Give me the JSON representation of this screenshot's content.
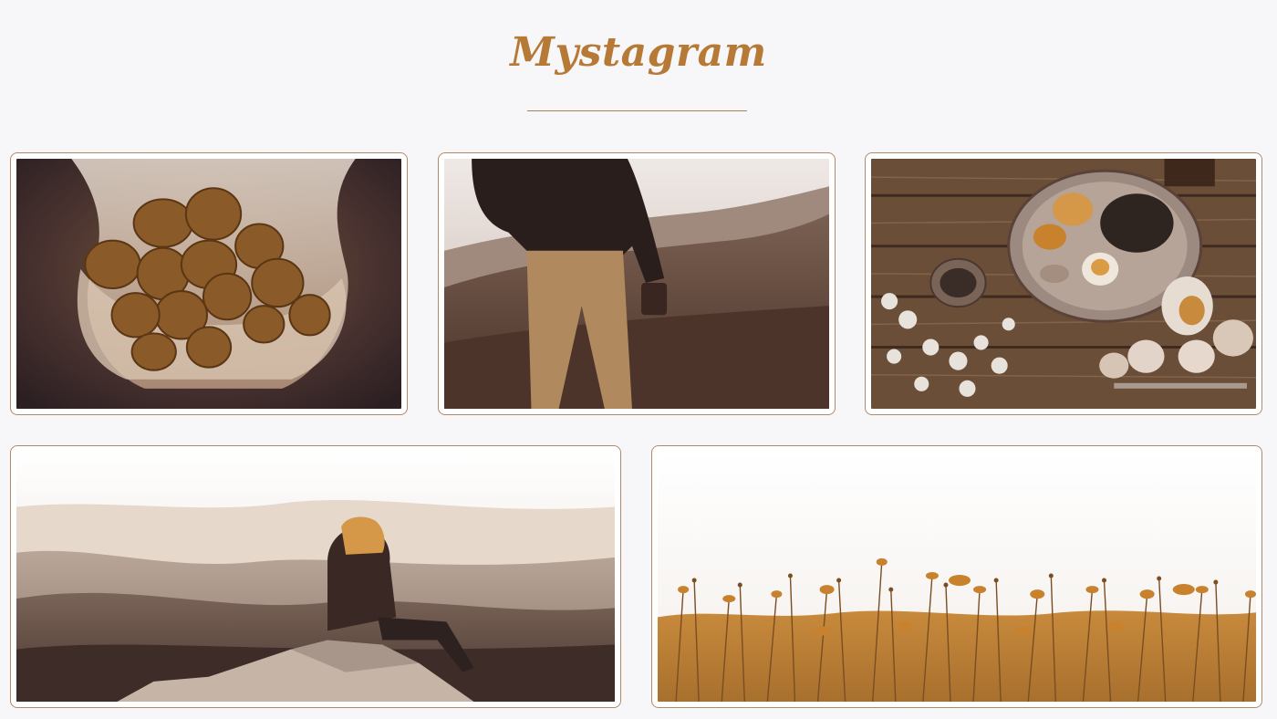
{
  "header": {
    "title": "Mystagram"
  },
  "gallery": {
    "photos": [
      {
        "subject": "hands-holding-strawberries"
      },
      {
        "subject": "person-holding-camera-on-hillside"
      },
      {
        "subject": "food-plate-on-wooden-table"
      },
      {
        "subject": "woman-sitting-on-rock-overlooking-mountains"
      },
      {
        "subject": "wildflower-meadow"
      }
    ]
  },
  "colors": {
    "background": "#f7f6f9",
    "accent": "#b77a36",
    "card_border": "#b08a68"
  }
}
